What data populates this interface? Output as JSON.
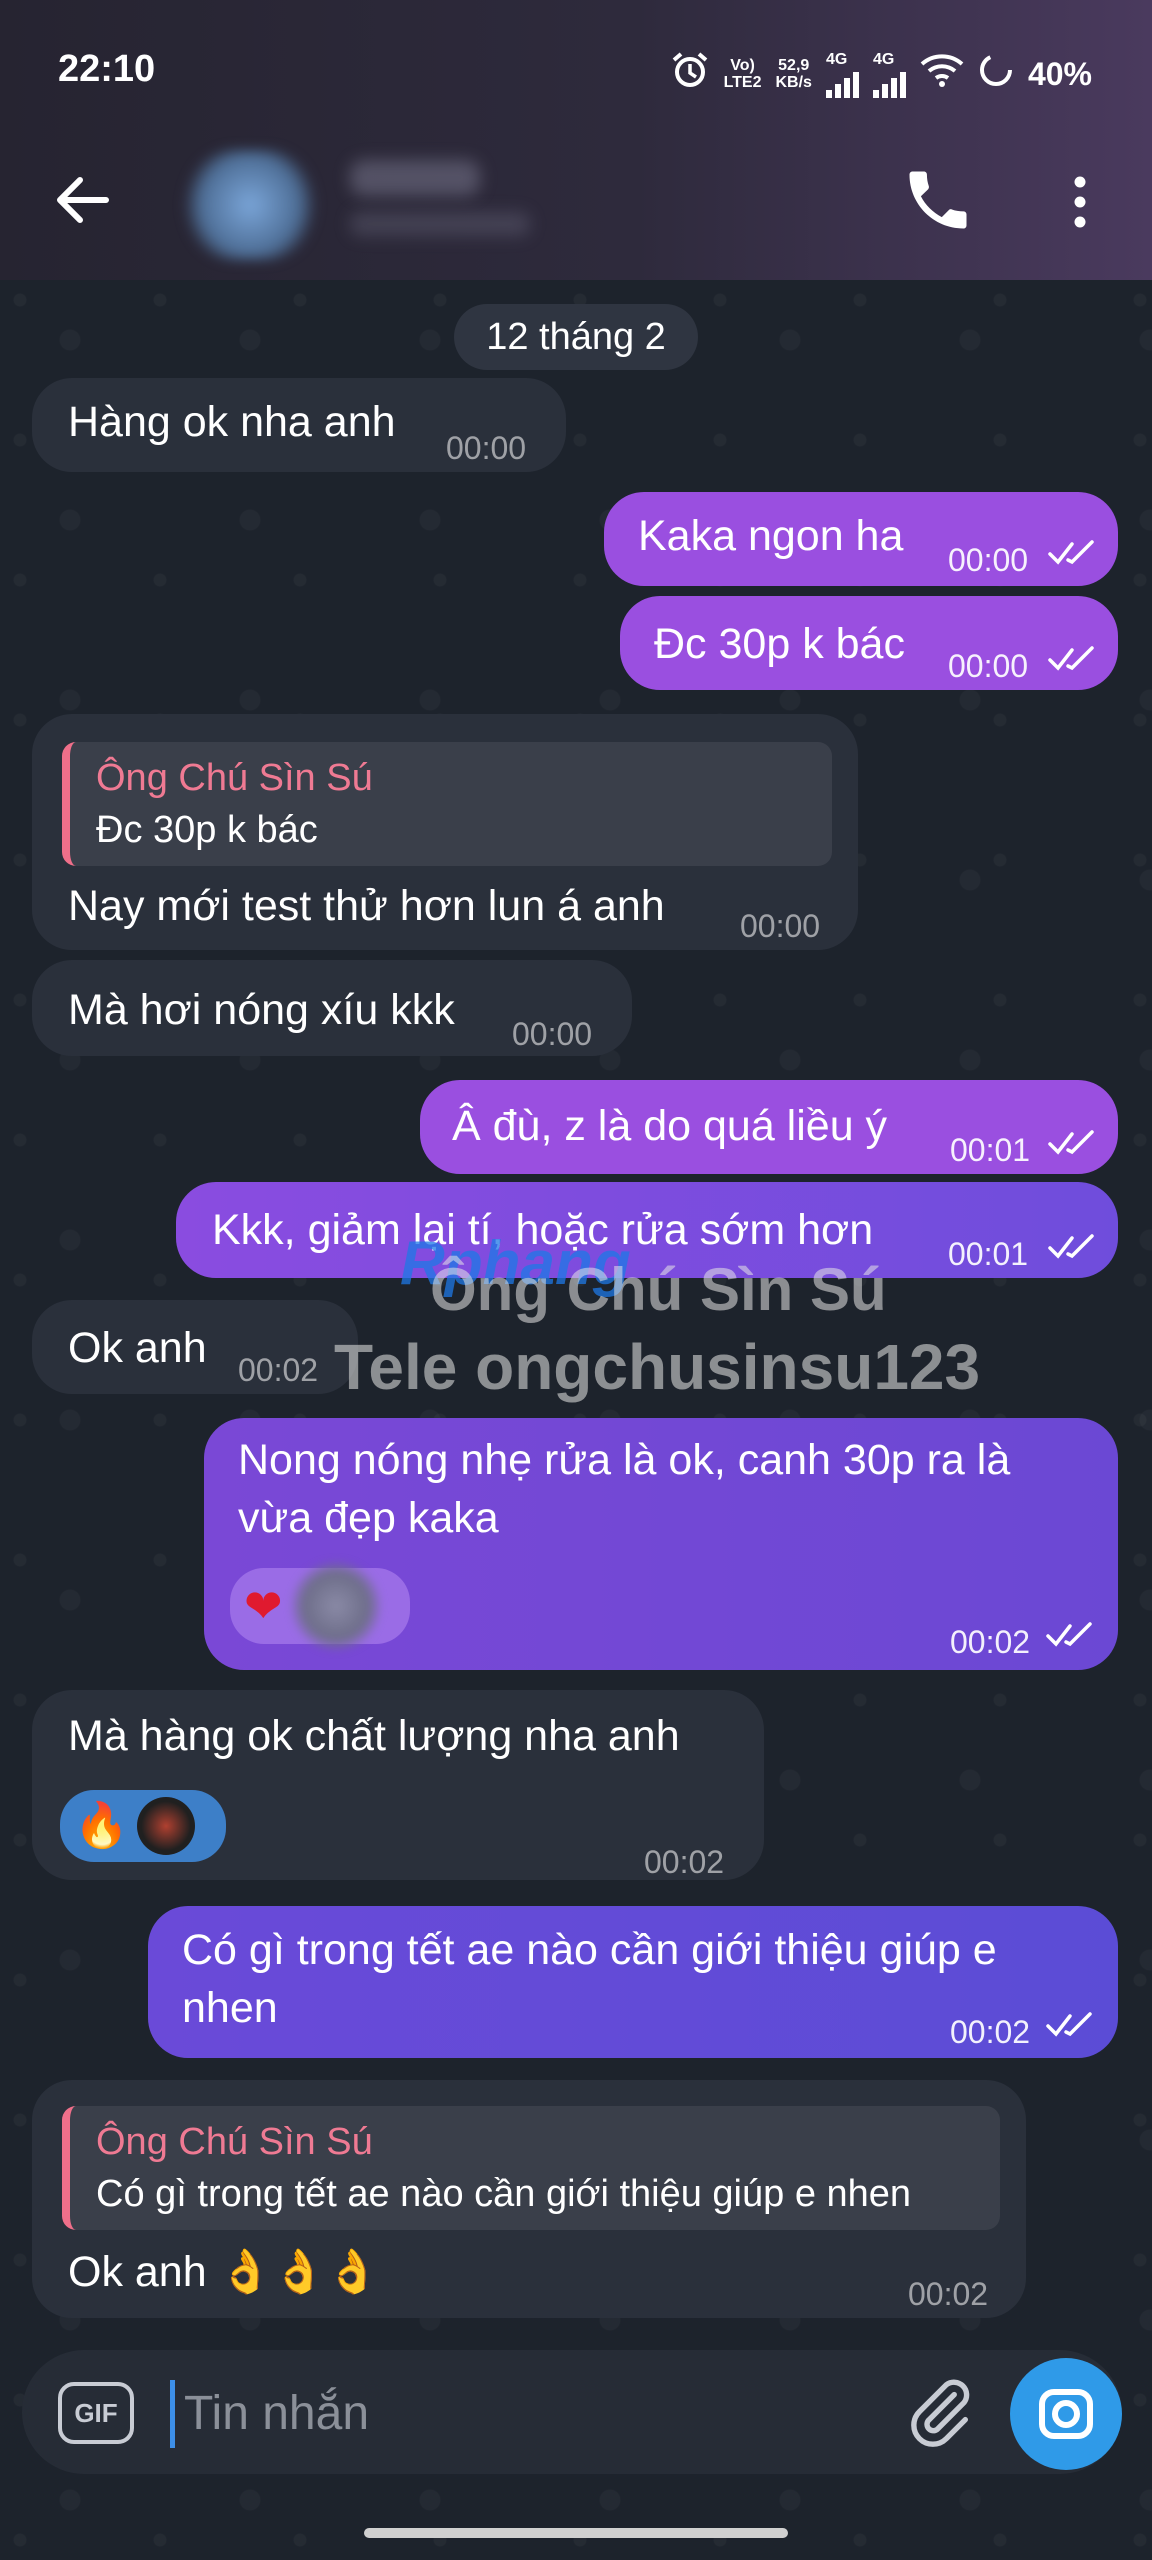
{
  "status_bar": {
    "time": "22:10",
    "volte": "Vo)\nLTE2",
    "net_speed": "52,9\nKB/s",
    "net1": "4G",
    "net2": "4G",
    "battery": "40%"
  },
  "app_bar": {
    "back_icon": "arrow-back-icon",
    "call_icon": "phone-icon",
    "more_icon": "more-vert-icon"
  },
  "date_chip": "12 tháng 2",
  "messages": [
    {
      "text": "Hàng ok nha anh",
      "time": "00:00"
    },
    {
      "text": "Kaka ngon ha",
      "time": "00:00"
    },
    {
      "text": "Đc 30p k bác",
      "time": "00:00"
    },
    {
      "reply_name": "Ông Chú Sìn Sú",
      "reply_text": "Đc 30p k bác",
      "text": "Nay mới test thử hơn lun á anh",
      "time": "00:00"
    },
    {
      "text": "Mà hơi nóng xíu kkk",
      "time": "00:00"
    },
    {
      "text": "Â đù, z là do quá liều ý",
      "time": "00:01"
    },
    {
      "text": "Kkk, giảm lại tí, hoặc rửa sớm hơn",
      "time": "00:01"
    },
    {
      "text": "Ok anh",
      "time": "00:02"
    },
    {
      "line1": "Nong nóng nhẹ rửa là ok, canh 30p ra là",
      "line2": "vừa đẹp kaka",
      "reaction": "❤",
      "time": "00:02"
    },
    {
      "text": "Mà hàng ok chất lượng nha anh",
      "reaction": "🔥",
      "time": "00:02"
    },
    {
      "line1": "Có gì trong tết ae nào cần giới thiệu giúp e",
      "line2": "nhen",
      "time": "00:02"
    },
    {
      "reply_name": "Ông Chú Sìn Sú",
      "reply_text": "Có gì trong tết ae nào cần giới thiệu giúp e nhen",
      "text": "Ok anh 👌👌👌",
      "time": "00:02"
    }
  ],
  "watermark": {
    "logo": "Rphang",
    "line1": "Ông Chú Sìn Sú",
    "line2": "Tele ongchusinsu123"
  },
  "composer": {
    "gif_label": "GIF",
    "placeholder": "Tin nhắn"
  },
  "colors": {
    "outgoing": "#9a4fe0",
    "incoming": "#2a303b",
    "reply_accent": "#ef6f8a",
    "camera": "#2f9ae8"
  }
}
